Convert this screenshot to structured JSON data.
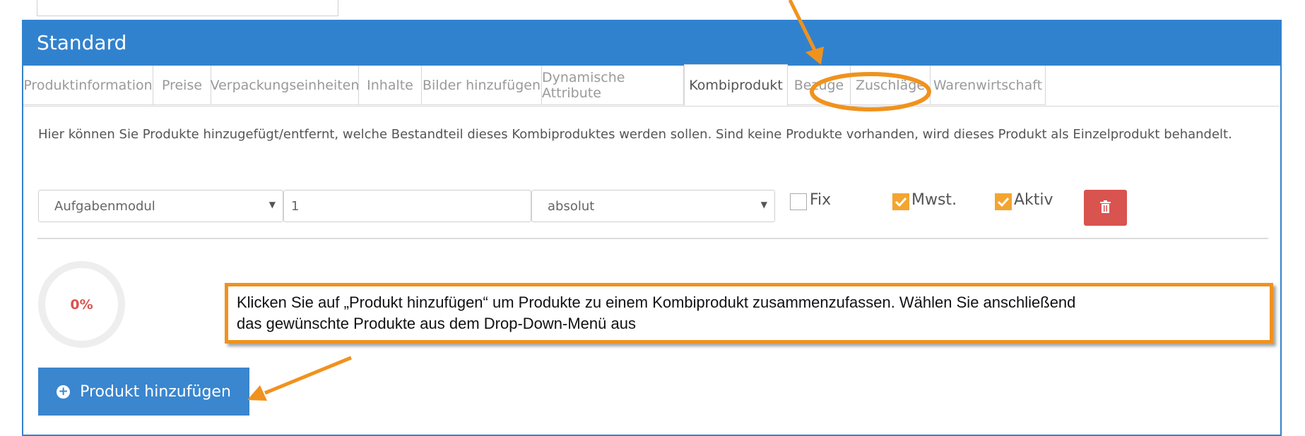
{
  "panel": {
    "title": "Standard"
  },
  "tabs": [
    {
      "label": "Produktinformation"
    },
    {
      "label": "Preise"
    },
    {
      "label": "Verpackungseinheiten"
    },
    {
      "label": "Inhalte"
    },
    {
      "label": "Bilder hinzufügen"
    },
    {
      "label": "Dynamische Attribute"
    },
    {
      "label": "Kombiprodukt",
      "active": true
    },
    {
      "label": "Bezüge"
    },
    {
      "label": "Zuschläge"
    },
    {
      "label": "Warenwirtschaft"
    }
  ],
  "info_text": "Hier können Sie Produkte hinzugefügt/entfernt, welche Bestandteil dieses Kombiproduktes werden sollen. Sind keine Produkte vorhanden, wird dieses Produkt als Einzelprodukt behandelt.",
  "row": {
    "product_select": "Aufgabenmodul",
    "quantity": "1",
    "mode_select": "absolut",
    "checkboxes": {
      "fix": {
        "label": "Fix",
        "checked": false
      },
      "mwst": {
        "label": "Mwst.",
        "checked": true
      },
      "aktiv": {
        "label": "Aktiv",
        "checked": true
      }
    }
  },
  "progress": {
    "label": "0%",
    "value": 0
  },
  "add_button": {
    "label": "Produkt hinzufügen"
  },
  "callout": {
    "line1": "Klicken Sie auf „Produkt hinzufügen“ um Produkte zu einem Kombiprodukt zusammenzufassen.  Wählen Sie anschließend",
    "line2": "das gewünschte Produkte aus dem Drop-Down-Menü aus"
  },
  "colors": {
    "header": "#3182ce",
    "button": "#3a86cf",
    "danger": "#d9534f",
    "checkbox": "#f3a530",
    "annotation": "#f0921e"
  },
  "icons": {
    "delete": "trash-icon",
    "add": "plus-circle-icon",
    "dropdown": "caret-down-icon"
  }
}
